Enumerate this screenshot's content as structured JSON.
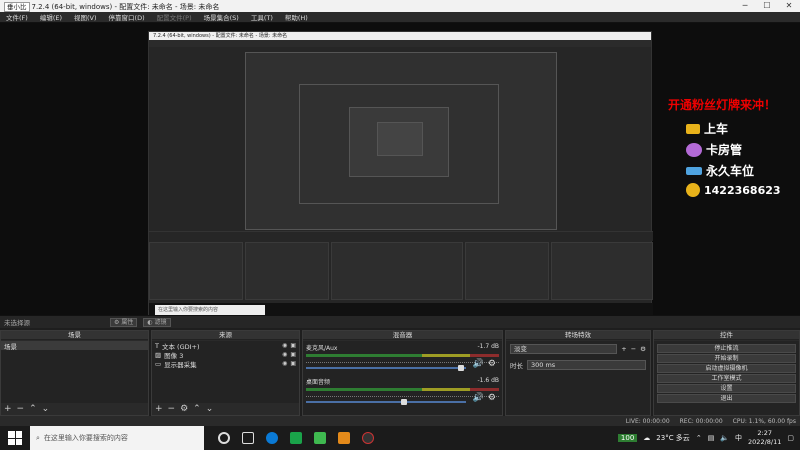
{
  "app": {
    "title_tag": "垂小比",
    "title": "7.2.4 (64-bit, windows) - 配置文件: 未命名 - 场景: 未命名"
  },
  "menu": [
    "文件(F)",
    "编辑(E)",
    "视图(V)",
    "停靠窗口(D)",
    "配置文件(P)",
    "场景集合(S)",
    "工具(T)",
    "帮助(H)"
  ],
  "overlay": {
    "heading": "开通粉丝灯牌来冲！",
    "items": [
      "上车",
      "卡房管",
      "永久车位",
      "1422368623"
    ]
  },
  "nested": {
    "title": "7.2.4 (64-bit, windows) - 配置文件: 未命名 - 场景: 未命名",
    "search": "在这里输入你要搜索的内容"
  },
  "status_row": {
    "label": "未选择源",
    "props": "属性",
    "filters": "滤镜"
  },
  "docks": {
    "scenes": {
      "header": "场景",
      "items": [
        "场景"
      ]
    },
    "sources": {
      "header": "来源",
      "items": [
        "文本 (GDI+)",
        "图像 3",
        "显示器采集"
      ]
    },
    "mixer": {
      "header": "混音器",
      "channels": [
        {
          "name": "麦克风/Aux",
          "db": "-1.7 dB",
          "level": 0.99
        },
        {
          "name": "桌面音频",
          "db": "-1.6 dB",
          "level": 0.62
        }
      ]
    },
    "transitions": {
      "header": "转场特效",
      "type": "淡变",
      "duration_label": "时长",
      "duration": "300 ms"
    },
    "controls": {
      "header": "控件",
      "buttons": [
        "停止推流",
        "开始录制",
        "启动虚拟摄像机",
        "工作室模式",
        "设置",
        "退出"
      ]
    }
  },
  "statusbar": {
    "live": "LIVE: 00:00:00",
    "rec": "REC: 00:00:00",
    "cpu": "CPU: 1.1%, 60.00 fps"
  },
  "taskbar": {
    "search_placeholder": "在这里输入你要搜索的内容",
    "battery": "100",
    "weather": "23°C 多云",
    "time": "2:27",
    "date": "2022/8/11"
  }
}
